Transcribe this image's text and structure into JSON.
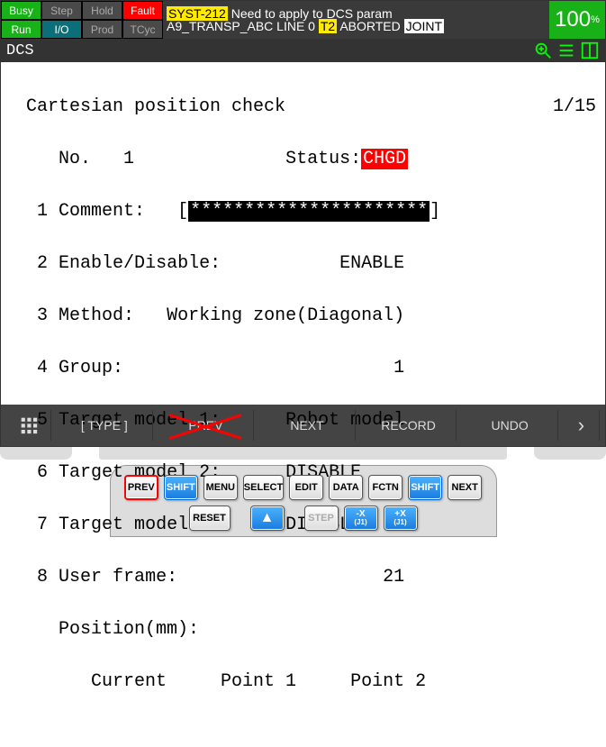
{
  "status": {
    "busy": "Busy",
    "step": "Step",
    "hold": "Hold",
    "fault": "Fault",
    "run": "Run",
    "io": "I/O",
    "prod": "Prod",
    "tcyc": "TCyc",
    "msg_code": "SYST-212",
    "msg_text": "Need to apply to DCS param",
    "prog": "A9_TRANSP_ABC LINE 0",
    "t2": "T2",
    "state": "ABORTED",
    "mode": "JOINT",
    "pct": "100",
    "pct_unit": "%"
  },
  "title": "DCS",
  "page": {
    "header": "Cartesian position check",
    "pager": "1/15",
    "no_label": "No.",
    "no_value": "1",
    "status_label": "Status:",
    "status_value": "CHGD",
    "items": [
      {
        "n": "1",
        "label": "Comment:",
        "value_pre": "[",
        "stars": "**********************",
        "value_post": "]"
      },
      {
        "n": "2",
        "label": "Enable/Disable:",
        "value": "ENABLE"
      },
      {
        "n": "3",
        "label": "Method:",
        "value": "Working zone(Diagonal)"
      },
      {
        "n": "4",
        "label": "Group:",
        "value": "1"
      },
      {
        "n": "5",
        "label": "Target model 1:",
        "value": "Robot model"
      },
      {
        "n": "6",
        "label": "Target model 2:",
        "value": "DISABLE"
      },
      {
        "n": "7",
        "label": "Target model 3:",
        "value": "DISABLE"
      },
      {
        "n": "8",
        "label": "User frame:",
        "value": "21"
      }
    ],
    "pos_label": "Position(mm):",
    "col_current": "Current",
    "col_p1": "Point 1",
    "col_p2": "Point 2"
  },
  "softkeys": {
    "type": "[ TYPE ]",
    "prev": "PREV",
    "next": "NEXT",
    "record": "RECORD",
    "undo": "UNDO"
  },
  "pendant": {
    "row1": [
      "PREV",
      "SHIFT",
      "MENU",
      "SELECT",
      "EDIT",
      "DATA",
      "FCTN",
      "SHIFT",
      "NEXT"
    ],
    "row2_reset": "RESET",
    "row2_step": "STEP",
    "jog_minus": "-X",
    "jog_minus_sub": "(J1)",
    "jog_plus": "+X",
    "jog_plus_sub": "(J1)"
  }
}
